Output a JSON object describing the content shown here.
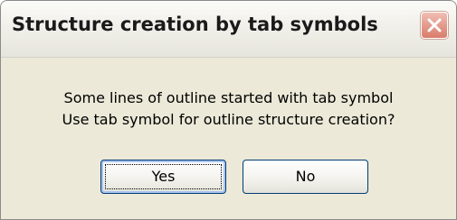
{
  "window": {
    "title": "Structure creation by tab symbols"
  },
  "message": {
    "line1": "Some lines of outline started with tab symbol",
    "line2": "Use tab symbol for outline structure creation?"
  },
  "buttons": {
    "yes_label": "Yes",
    "no_label": "No"
  },
  "icons": {
    "close": "close-icon"
  },
  "colors": {
    "dialog_bg": "#ece9d8",
    "button_border": "#003c74",
    "close_button": "#e59b8c"
  }
}
